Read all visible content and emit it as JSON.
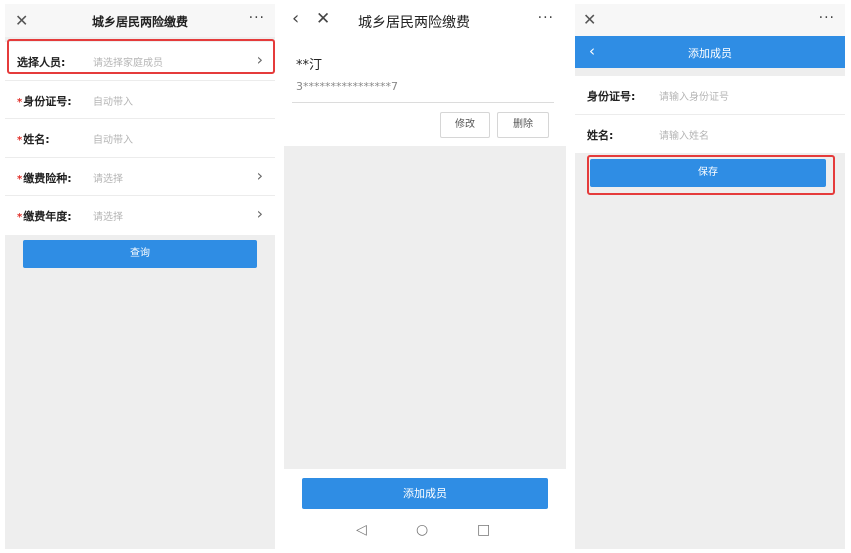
{
  "panel1": {
    "header": {
      "close_icon": "close-icon",
      "title": "城乡居民两险缴费",
      "more": "···"
    },
    "rows": [
      {
        "label": "选择人员:",
        "required": false,
        "placeholder": "请选择家庭成员",
        "chevron": true
      },
      {
        "label": "身份证号:",
        "required": true,
        "placeholder": "自动带入",
        "chevron": false
      },
      {
        "label": "姓名:",
        "required": true,
        "placeholder": "自动带入",
        "chevron": false
      },
      {
        "label": "缴费险种:",
        "required": true,
        "placeholder": "请选择",
        "chevron": true
      },
      {
        "label": "缴费年度:",
        "required": true,
        "placeholder": "请选择",
        "chevron": true
      }
    ],
    "required_mark": "*",
    "query_button": "查询",
    "chevron_glyph": "›"
  },
  "panel2": {
    "header": {
      "back_icon": "back-icon",
      "close_icon": "close-icon",
      "title": "城乡居民两险缴费",
      "more": "···"
    },
    "member": {
      "name": "**汀",
      "id": "3****************7"
    },
    "edit_button": "修改",
    "delete_button": "删除",
    "add_button": "添加成员",
    "nav": {
      "back": "◁",
      "home": "○",
      "recent": "□"
    }
  },
  "panel3": {
    "header": {
      "close_icon": "close-icon",
      "more": "···"
    },
    "bar": {
      "back": "‹",
      "title": "添加成员"
    },
    "rows": [
      {
        "label": "身份证号:",
        "placeholder": "请输入身份证号"
      },
      {
        "label": "姓名:",
        "placeholder": "请输入姓名"
      }
    ],
    "save_button": "保存"
  },
  "colors": {
    "accent": "#2f8de4",
    "highlight": "#e53b3b",
    "required": "#e0302a"
  }
}
